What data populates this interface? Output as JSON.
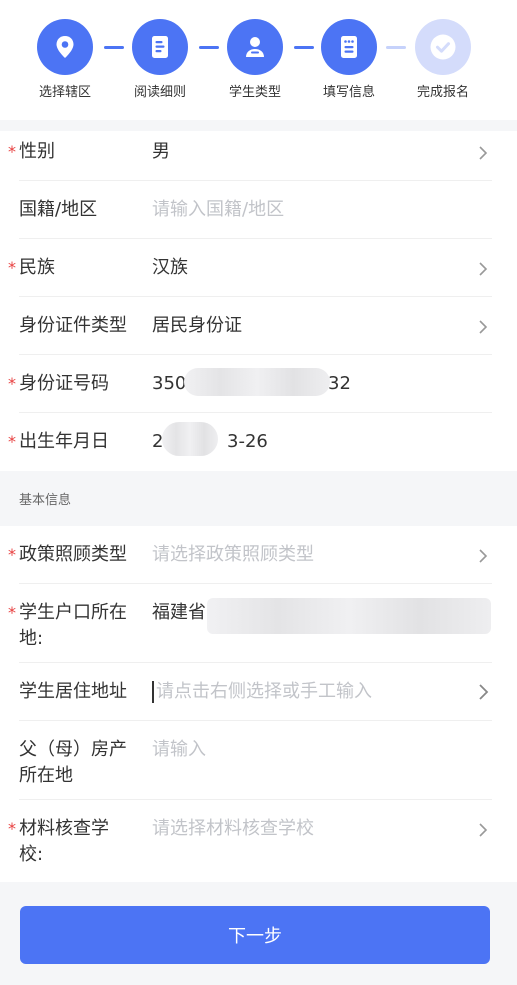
{
  "steps": [
    {
      "label": "选择辖区",
      "icon": "location-pin-icon",
      "state": "done"
    },
    {
      "label": "阅读细则",
      "icon": "document-icon",
      "state": "done"
    },
    {
      "label": "学生类型",
      "icon": "student-icon",
      "state": "done"
    },
    {
      "label": "填写信息",
      "icon": "form-icon",
      "state": "done"
    },
    {
      "label": "完成报名",
      "icon": "check-icon",
      "state": "pending"
    }
  ],
  "colors": {
    "accent": "#4c74f4",
    "pending": "#d4dcfb",
    "required": "#e84141",
    "placeholder": "#c2c4c9"
  },
  "form1": {
    "gender": {
      "label": "性别",
      "value": "男",
      "required": true
    },
    "nationality": {
      "label": "国籍/地区",
      "placeholder": "请输入国籍/地区"
    },
    "ethnicity": {
      "label": "民族",
      "value": "汉族",
      "required": true
    },
    "id_type": {
      "label": "身份证件类型",
      "value": "居民身份证"
    },
    "id_number": {
      "label": "身份证号码",
      "value_start": "350",
      "value_end": "32",
      "required": true
    },
    "birth_date": {
      "label": "出生年月日",
      "value_start": "2",
      "value_end": "3-26",
      "required": true
    }
  },
  "section_basic": "基本信息",
  "form2": {
    "policy_type": {
      "label": "政策照顾类型",
      "placeholder": "请选择政策照顾类型",
      "required": true
    },
    "household": {
      "label_line1": "学生户口所在",
      "label_line2": "地:",
      "value": "福建省",
      "required": true
    },
    "residence": {
      "label": "学生居住地址",
      "placeholder": "请点击右侧选择或手工输入"
    },
    "property": {
      "label_line1": "父（母）房产",
      "label_line2": "所在地",
      "placeholder": "请输入"
    },
    "review_school": {
      "label_line1": "材料核查学",
      "label_line2": "校:",
      "placeholder": "请选择材料核查学校",
      "required": true
    }
  },
  "next_button": "下一步"
}
